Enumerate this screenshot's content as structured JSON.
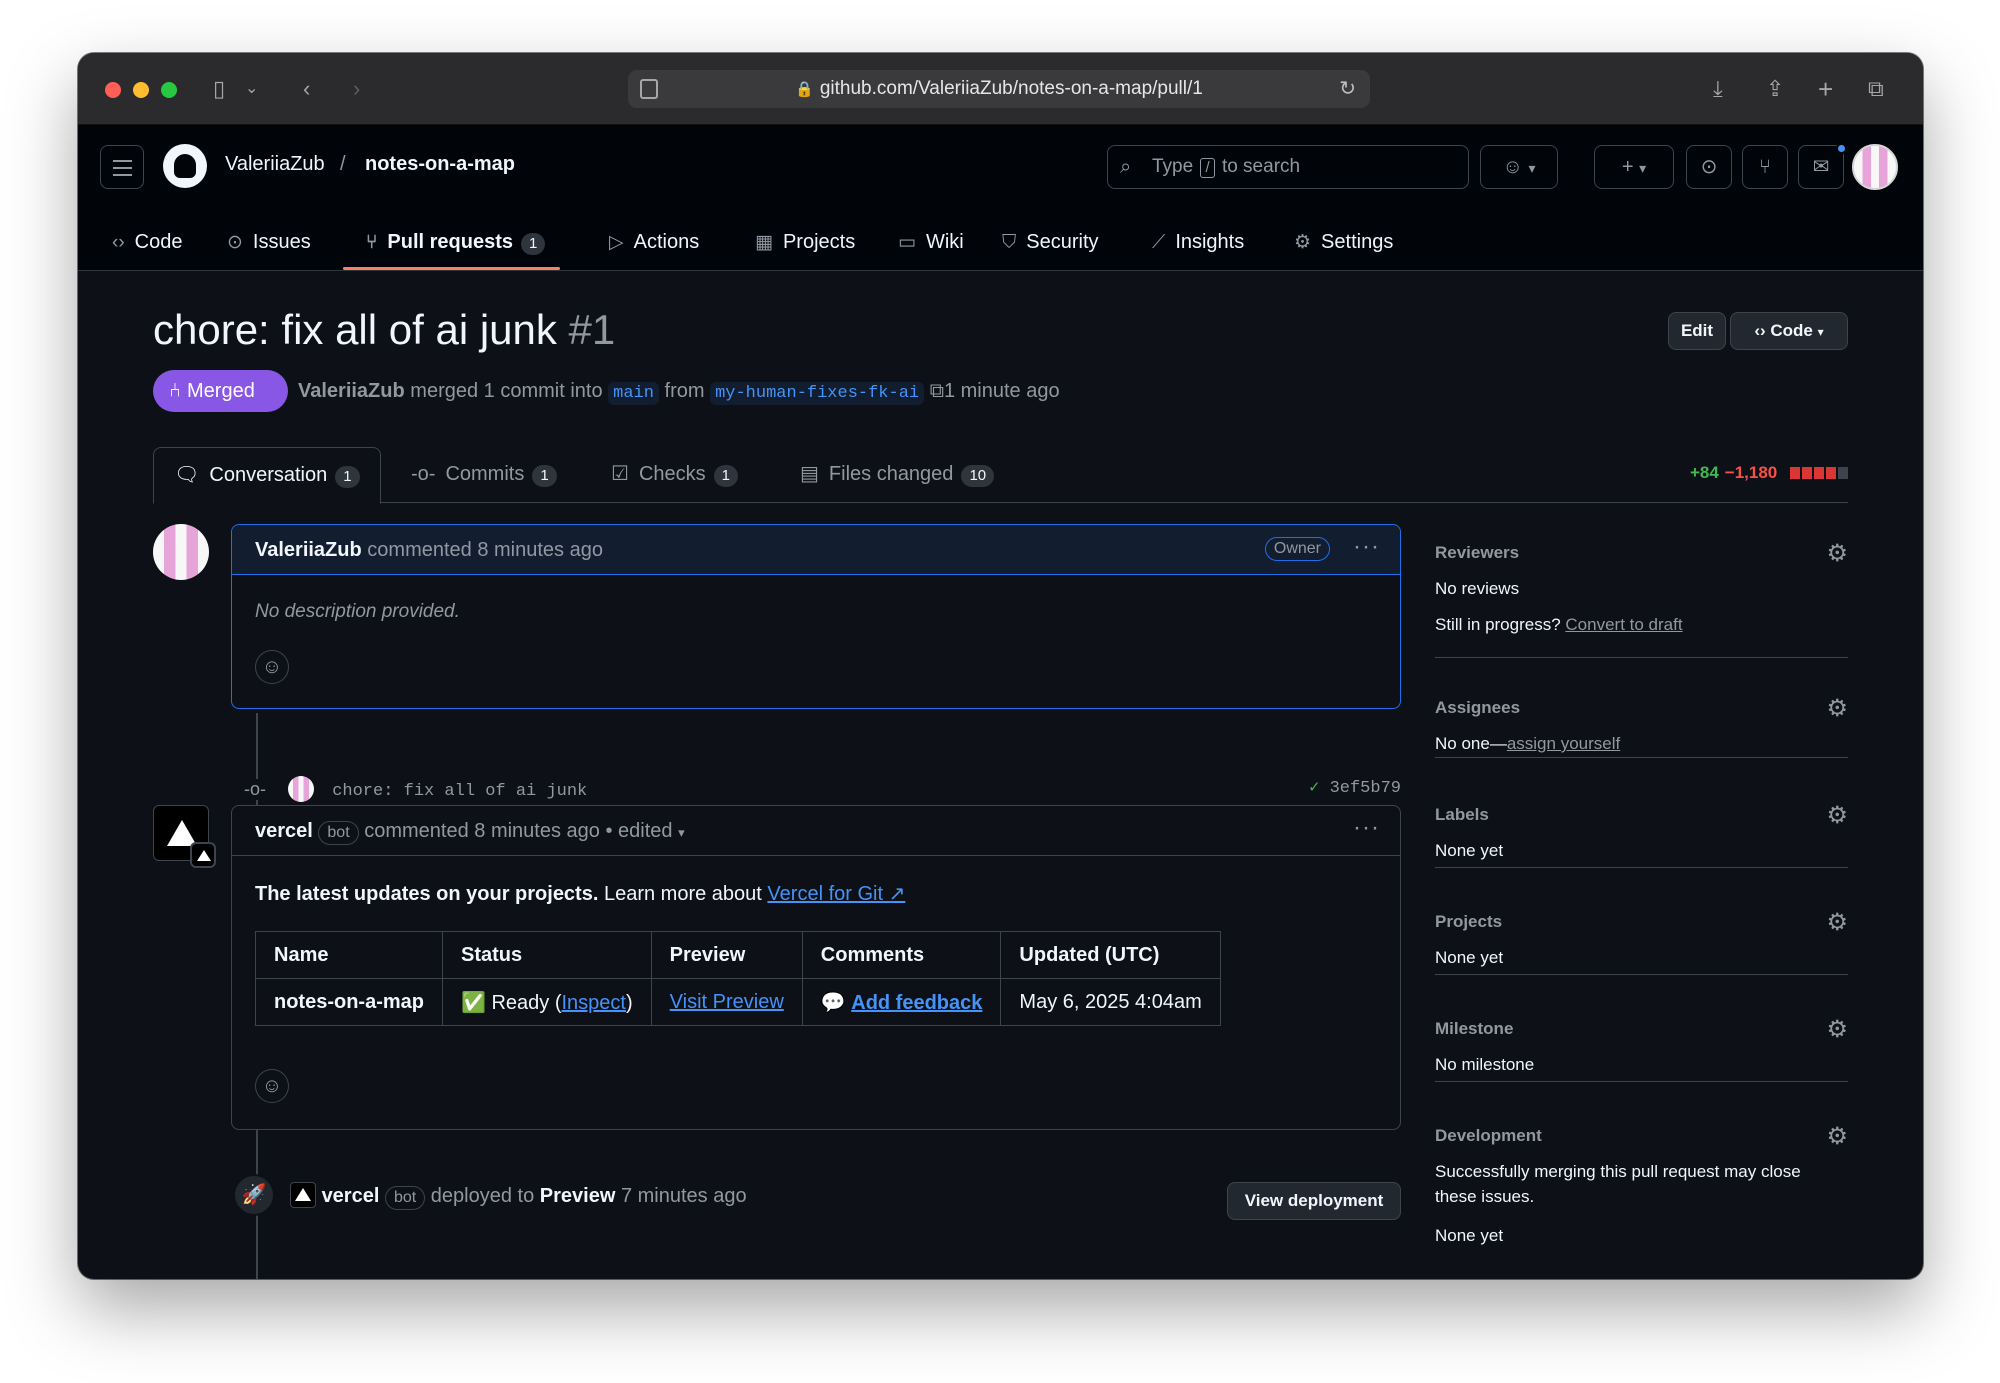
{
  "browser": {
    "url": "github.com/ValeriiaZub/notes-on-a-map/pull/1"
  },
  "header": {
    "owner": "ValeriiaZub",
    "slash": "/",
    "repo": "notes-on-a-map",
    "search_prefix": "Type",
    "search_key": "/",
    "search_suffix": "to search"
  },
  "repo_nav": [
    {
      "label": "Code",
      "icon": "code-icon"
    },
    {
      "label": "Issues",
      "icon": "issue-icon"
    },
    {
      "label": "Pull requests",
      "icon": "pull-request-icon",
      "count": "1"
    },
    {
      "label": "Actions",
      "icon": "play-icon"
    },
    {
      "label": "Projects",
      "icon": "table-icon"
    },
    {
      "label": "Wiki",
      "icon": "book-icon"
    },
    {
      "label": "Security",
      "icon": "shield-icon"
    },
    {
      "label": "Insights",
      "icon": "graph-icon"
    },
    {
      "label": "Settings",
      "icon": "gear-icon"
    }
  ],
  "pr": {
    "title": "chore: fix all of ai junk",
    "number": "#1",
    "edit_label": "Edit",
    "code_label": "Code",
    "state": "Merged",
    "author": "ValeriiaZub",
    "merged_text": "merged 1 commit into",
    "base": "main",
    "from": "from",
    "head": "my-human-fixes-fk-ai",
    "time": "1 minute ago"
  },
  "tabs": [
    {
      "label": "Conversation",
      "count": "1"
    },
    {
      "label": "Commits",
      "count": "1"
    },
    {
      "label": "Checks",
      "count": "1"
    },
    {
      "label": "Files changed",
      "count": "10"
    }
  ],
  "diffstat": {
    "additions": "+84",
    "deletions": "−1,180"
  },
  "comment1": {
    "author": "ValeriiaZub",
    "action": "commented 8 minutes ago",
    "badge": "Owner",
    "body": "No description provided."
  },
  "commit": {
    "message": "chore: fix all of ai junk",
    "sha": "3ef5b79"
  },
  "comment2": {
    "author": "vercel",
    "bot": "bot",
    "action": "commented 8 minutes ago • edited",
    "lead_bold": "The latest updates on your projects.",
    "lead_rest": "Learn more about",
    "lead_link": "Vercel for Git ↗",
    "table": {
      "headers": [
        "Name",
        "Status",
        "Preview",
        "Comments",
        "Updated (UTC)"
      ],
      "row": {
        "name": "notes-on-a-map",
        "status_emoji": "✅",
        "status": "Ready",
        "inspect": "Inspect",
        "preview": "Visit Preview",
        "comments_emoji": "💬",
        "comments": "Add feedback",
        "updated": "May 6, 2025 4:04am"
      }
    }
  },
  "deploy": {
    "author": "vercel",
    "bot": "bot",
    "text": "deployed to",
    "env": "Preview",
    "time": "7 minutes ago",
    "button": "View deployment"
  },
  "sidebar": {
    "reviewers": {
      "title": "Reviewers",
      "value": "No reviews",
      "progress": "Still in progress?",
      "link": "Convert to draft"
    },
    "assignees": {
      "title": "Assignees",
      "value": "No one—",
      "link": "assign yourself"
    },
    "labels": {
      "title": "Labels",
      "value": "None yet"
    },
    "projects": {
      "title": "Projects",
      "value": "None yet"
    },
    "milestone": {
      "title": "Milestone",
      "value": "No milestone"
    },
    "development": {
      "title": "Development",
      "line1": "Successfully merging this pull request may close",
      "line2": "these issues.",
      "value": "None yet"
    }
  }
}
